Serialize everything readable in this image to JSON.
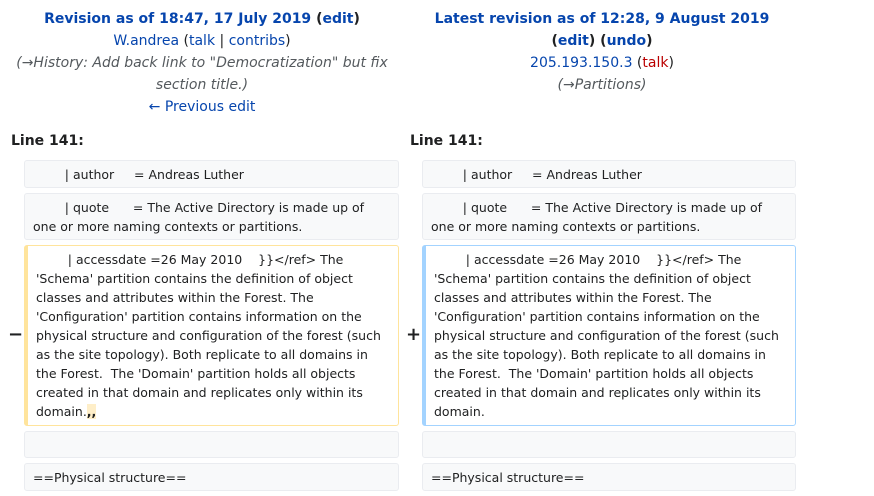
{
  "left": {
    "title_prefix": "Revision as of 18:47, 17 July 2019",
    "edit": "edit",
    "user": "W.andrea",
    "talk": "talk",
    "contribs": "contribs",
    "summary_line1": "(→History:  Add back link to \"Democratization\" but fix",
    "summary_line2": "section title.)",
    "prev_edit": "← Previous edit"
  },
  "right": {
    "title": "Latest revision as of 12:28, 9 August 2019",
    "edit": "edit",
    "undo": "undo",
    "user": "205.193.150.3",
    "talk": "talk",
    "summary": "(→Partitions)"
  },
  "diff": {
    "line_label_left": "Line 141:",
    "line_label_right": "Line 141:",
    "row1": "        | author     = Andreas Luther",
    "row2": "        | quote      = The Active Directory is made up of one or more naming contexts or partitions.",
    "left_changed": "        | accessdate =26 May 2010    }}</ref> The 'Schema' partition contains the definition of object classes and attributes within the Forest. The 'Configuration' partition contains information on the physical structure and configuration of the forest (such as the site topology). Both replicate to all domains in the Forest.  The 'Domain' partition holds all objects created in that domain and replicates only within its domain.",
    "left_deleted": ",,",
    "right_changed": "        | accessdate =26 May 2010    }}</ref> The 'Schema' partition contains the definition of object classes and attributes within the Forest. The 'Configuration' partition contains information on the physical structure and configuration of the forest (such as the site topology). Both replicate to all domains in the Forest.  The 'Domain' partition holds all objects created in that domain and replicates only within its domain.",
    "minus": "−",
    "plus": "+",
    "row_last": "==Physical structure=="
  }
}
